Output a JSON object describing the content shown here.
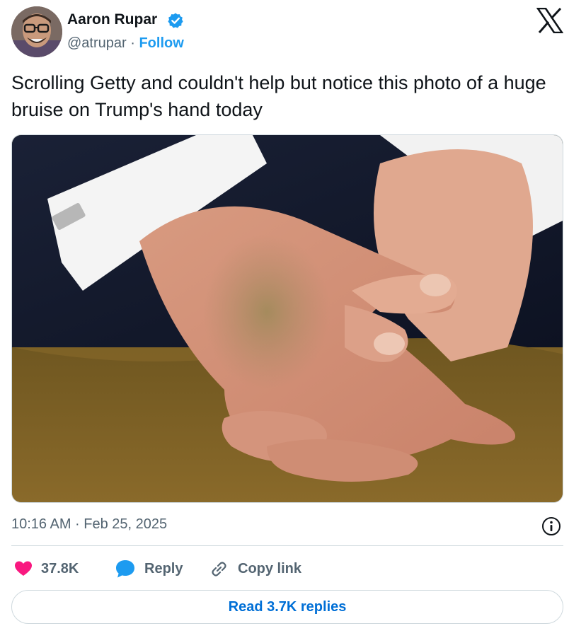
{
  "author": {
    "name": "Aaron Rupar",
    "handle": "@atrupar",
    "separator": "·",
    "follow_label": "Follow",
    "verified": true
  },
  "platform": {
    "logo_icon": "x-logo-icon"
  },
  "tweet": {
    "text": "Scrolling Getty and couldn't help but notice this photo of a huge bruise on Trump's hand today"
  },
  "media": {
    "icon": "photo-clasped-hands"
  },
  "meta": {
    "timestamp": "10:16 AM · Feb 25, 2025",
    "info_icon": "info-icon"
  },
  "actions": {
    "like_count": "37.8K",
    "reply_label": "Reply",
    "copy_link_label": "Copy link"
  },
  "footer": {
    "read_replies_label": "Read 3.7K replies"
  },
  "colors": {
    "accent": "#1d9bf0",
    "link_dark": "#006fd6",
    "like": "#f91880",
    "text_primary": "#0f1419",
    "text_secondary": "#536471",
    "border": "#cfd9de"
  }
}
